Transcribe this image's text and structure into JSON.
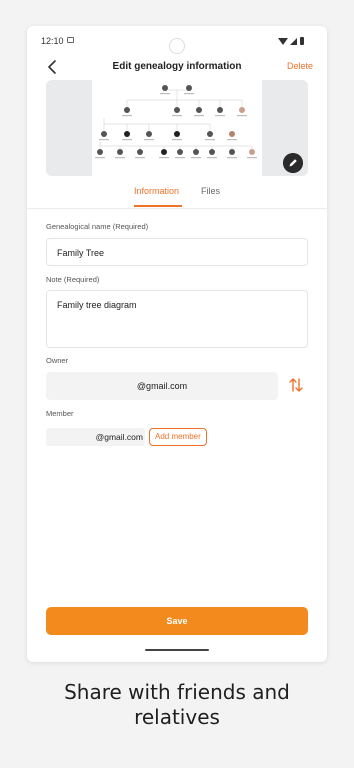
{
  "status_bar": {
    "time": "12:10"
  },
  "header": {
    "title": "Edit genealogy information",
    "delete_label": "Delete"
  },
  "tabs": [
    {
      "label": "Information",
      "active": true
    },
    {
      "label": "Files",
      "active": false
    }
  ],
  "form": {
    "name": {
      "label": "Genealogical name (Required)",
      "value": "Family Tree"
    },
    "note": {
      "label": "Note (Required)",
      "value": "Family tree diagram"
    },
    "owner": {
      "label": "Owner",
      "value": "@gmail.com"
    },
    "member": {
      "label": "Member",
      "value": "@gmail.com",
      "add_label": "Add member"
    }
  },
  "save_label": "Save",
  "caption_line1": "Share with friends and",
  "caption_line2": "relatives",
  "colors": {
    "accent": "#f0712a",
    "save_button": "#f28a1d",
    "fab": "#2b2b2b"
  },
  "icons": [
    "back-arrow-icon",
    "pencil-icon",
    "swap-icon",
    "wifi-icon",
    "signal-icon",
    "battery-icon"
  ]
}
